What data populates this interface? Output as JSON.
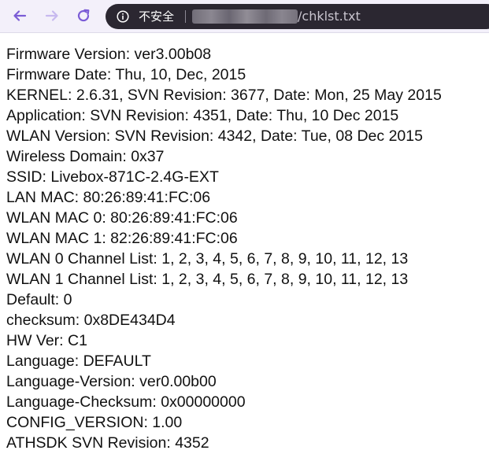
{
  "browser": {
    "nav": {
      "back_icon": "arrow-left-icon",
      "forward_icon": "arrow-right-icon",
      "reload_icon": "reload-icon"
    },
    "omnibox": {
      "info_icon": "info-circle-icon",
      "security_label": "不安全",
      "url_path": "/chklst.txt"
    },
    "colors": {
      "toolbar_bg": "#f3f0fa",
      "nav_icon": "#7b5cd6",
      "omnibox_bg": "#2b2731"
    }
  },
  "document": {
    "lines": [
      "Firmware Version: ver3.00b08",
      "Firmware Date: Thu, 10, Dec, 2015",
      "KERNEL: 2.6.31, SVN Revision: 3677, Date: Mon, 25 May 2015",
      "Application: SVN Revision: 4351, Date: Thu, 10 Dec 2015",
      "WLAN Version: SVN Revision: 4342, Date: Tue, 08 Dec 2015",
      "Wireless Domain: 0x37",
      "SSID: Livebox-871C-2.4G-EXT",
      "LAN MAC: 80:26:89:41:FC:06",
      "WLAN MAC 0: 80:26:89:41:FC:06",
      "WLAN MAC 1: 82:26:89:41:FC:06",
      "WLAN 0 Channel List: 1, 2, 3, 4, 5, 6, 7, 8, 9, 10, 11, 12, 13",
      "WLAN 1 Channel List: 1, 2, 3, 4, 5, 6, 7, 8, 9, 10, 11, 12, 13",
      "Default: 0",
      "checksum: 0x8DE434D4",
      "HW Ver: C1",
      "Language: DEFAULT",
      "Language-Version: ver0.00b00",
      "Language-Checksum: 0x00000000",
      "CONFIG_VERSION: 1.00",
      "ATHSDK SVN Revision: 4352"
    ]
  }
}
